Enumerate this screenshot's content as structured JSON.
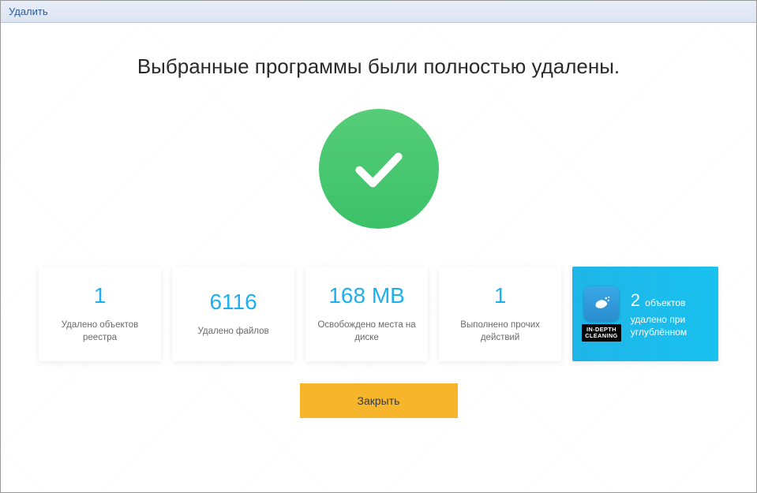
{
  "window": {
    "title": "Удалить"
  },
  "heading": "Выбранные программы были полностью удалены.",
  "stats": [
    {
      "value": "1",
      "label": "Удалено объектов реестра"
    },
    {
      "value": "6116",
      "label": "Удалено файлов"
    },
    {
      "value": "168 MB",
      "label": "Освобождено места на диске"
    },
    {
      "value": "1",
      "label": "Выполнено прочих действий"
    }
  ],
  "promo": {
    "badge": "IN-DEPTH\nCLEANING",
    "count": "2",
    "count_suffix": "объектов",
    "line2": "удалено при углублённом"
  },
  "buttons": {
    "close": "Закрыть"
  },
  "colors": {
    "accent": "#1cb0f1",
    "success": "#46c66f",
    "action": "#f7b52c",
    "promo": "#19c1ee"
  }
}
